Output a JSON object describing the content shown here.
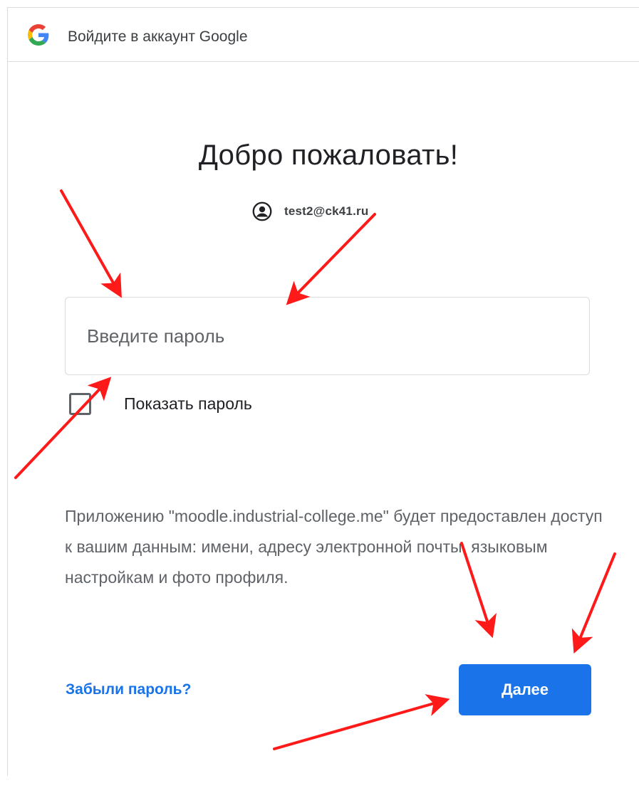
{
  "header": {
    "title": "Войдите в аккаунт Google",
    "logo_icon": "google-g-icon"
  },
  "welcome": {
    "heading": "Добро пожаловать!"
  },
  "account": {
    "icon": "account-circle-icon",
    "email": "test2@ck41.ru"
  },
  "password": {
    "placeholder": "Введите пароль",
    "value": ""
  },
  "show_password": {
    "label": "Показать пароль",
    "checked": false
  },
  "consent": {
    "text": "Приложению \"moodle.industrial-college.me\" будет предоставлен доступ к вашим данным: имени, адресу электронной почты, языковым настройкам и фото профиля."
  },
  "actions": {
    "forgot_label": "Забыли пароль?",
    "next_label": "Далее"
  },
  "colors": {
    "primary": "#1a73e8",
    "annotation_arrow": "#ff1a1a",
    "border": "#dadce0",
    "secondary_text": "#5f6368"
  }
}
